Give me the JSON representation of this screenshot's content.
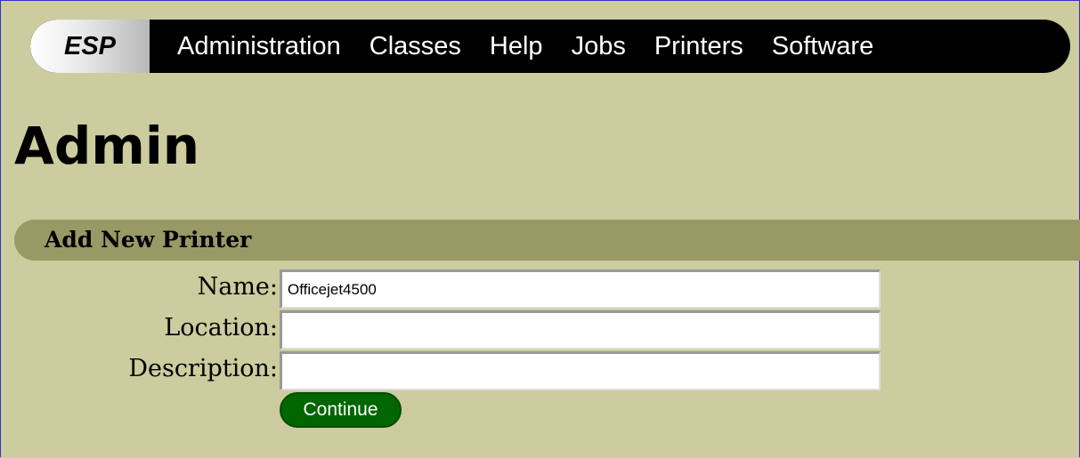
{
  "navbar": {
    "brand": "ESP",
    "items": [
      {
        "label": "Administration"
      },
      {
        "label": "Classes"
      },
      {
        "label": "Help"
      },
      {
        "label": "Jobs"
      },
      {
        "label": "Printers"
      },
      {
        "label": "Software"
      }
    ]
  },
  "page": {
    "title": "Admin"
  },
  "section": {
    "title": "Add New Printer"
  },
  "form": {
    "name_label": "Name:",
    "name_value": "Officejet4500",
    "location_label": "Location:",
    "location_value": "",
    "description_label": "Description:",
    "description_value": "",
    "continue_label": "Continue"
  },
  "colors": {
    "page_background": "#cccc9f",
    "navbar_background": "#000000",
    "section_bar": "#999966",
    "button_green": "#006600"
  }
}
